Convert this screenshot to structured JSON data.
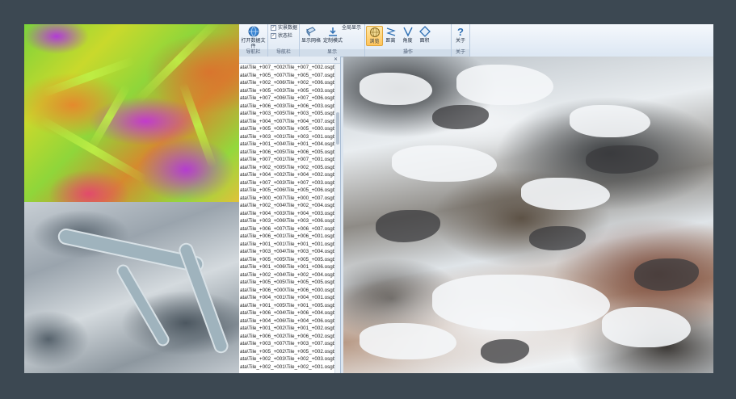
{
  "ribbon": {
    "open_file_label": "打开数据文件",
    "check_items": [
      {
        "label": "实景数据",
        "checked": true
      },
      {
        "label": "状态栏",
        "checked": true
      }
    ],
    "show_grid_label": "显示网格",
    "custom_mode_label": "定制模式",
    "fullscreen_label": "全局显示",
    "browse_label": "浏览",
    "distance_label": "距离",
    "angle_label": "角度",
    "area_label": "面积",
    "about_label": "关于",
    "groups": {
      "navigation": "导航栏",
      "display": "显示",
      "operation": "操作",
      "about": "关于"
    }
  },
  "file_panel": {
    "close_glyph": "✕",
    "files": [
      "ata\\Tile_+007_+002\\Tile_+007_+002.osgb",
      "ata\\Tile_+005_+007\\Tile_+005_+007.osgb",
      "ata\\Tile_+002_+006\\Tile_+002_+006.osgb",
      "ata\\Tile_+005_+003\\Tile_+005_+003.osgb",
      "ata\\Tile_+007_+006\\Tile_+007_+006.osgb",
      "ata\\Tile_+006_+003\\Tile_+006_+003.osgb",
      "ata\\Tile_+003_+005\\Tile_+003_+005.osgb",
      "ata\\Tile_+004_+007\\Tile_+004_+007.osgb",
      "ata\\Tile_+005_+000\\Tile_+005_+000.osgb",
      "ata\\Tile_+003_+001\\Tile_+003_+001.osgb",
      "ata\\Tile_+001_+004\\Tile_+001_+004.osgb",
      "ata\\Tile_+006_+005\\Tile_+006_+005.osgb",
      "ata\\Tile_+007_+001\\Tile_+007_+001.osgb",
      "ata\\Tile_+002_+005\\Tile_+002_+005.osgb",
      "ata\\Tile_+004_+002\\Tile_+004_+002.osgb",
      "ata\\Tile_+007_+003\\Tile_+007_+003.osgb",
      "ata\\Tile_+005_+006\\Tile_+005_+006.osgb",
      "ata\\Tile_+000_+007\\Tile_+000_+007.osgb",
      "ata\\Tile_+002_+004\\Tile_+002_+004.osgb",
      "ata\\Tile_+004_+003\\Tile_+004_+003.osgb",
      "ata\\Tile_+003_+006\\Tile_+003_+006.osgb",
      "ata\\Tile_+006_+007\\Tile_+006_+007.osgb",
      "ata\\Tile_+006_+001\\Tile_+006_+001.osgb",
      "ata\\Tile_+001_+001\\Tile_+001_+001.osgb",
      "ata\\Tile_+003_+004\\Tile_+003_+004.osgb",
      "ata\\Tile_+005_+005\\Tile_+005_+005.osgb",
      "ata\\Tile_+001_+006\\Tile_+001_+006.osgb",
      "ata\\Tile_+002_+004\\Tile_+002_+004.osgb",
      "ata\\Tile_+005_+005\\Tile_+005_+005.osgb",
      "ata\\Tile_+006_+000\\Tile_+006_+000.osgb",
      "ata\\Tile_+004_+001\\Tile_+004_+001.osgb",
      "ata\\Tile_+001_+005\\Tile_+001_+005.osgb",
      "ata\\Tile_+006_+004\\Tile_+006_+004.osgb",
      "ata\\Tile_+004_+006\\Tile_+004_+006.osgb",
      "ata\\Tile_+001_+002\\Tile_+001_+002.osgb",
      "ata\\Tile_+006_+002\\Tile_+006_+002.osgb",
      "ata\\Tile_+003_+007\\Tile_+003_+007.osgb",
      "ata\\Tile_+005_+002\\Tile_+005_+002.osgb",
      "ata\\Tile_+002_+003\\Tile_+002_+003.osgb",
      "ata\\Tile_+002_+001\\Tile_+002_+001.osgb"
    ]
  },
  "colors": {
    "frame": "#3c4852",
    "ribbon_accent": "#ffc45a",
    "heat_high": "#c23bcb",
    "heat_low": "#7ad33b"
  }
}
